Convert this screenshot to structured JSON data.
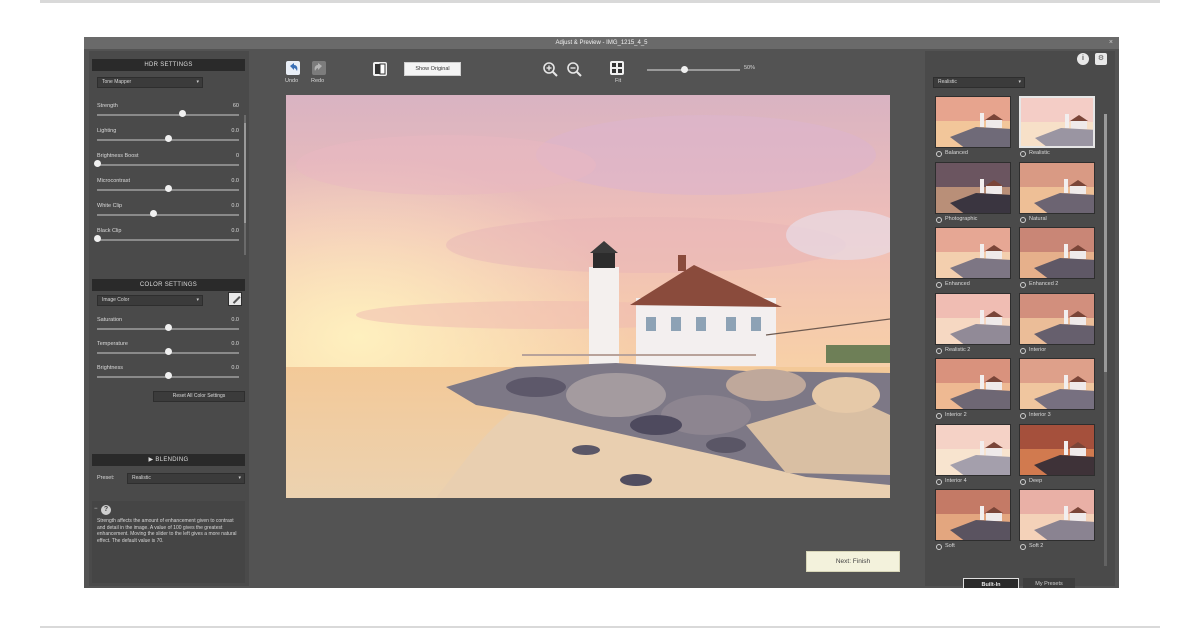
{
  "window": {
    "title": "Adjust & Preview - IMG_1215_4_5",
    "close_glyph": "×"
  },
  "left": {
    "hdr_settings_title": "HDR SETTINGS",
    "tone_dropdown": "Tone Mapper",
    "sliders": [
      {
        "label": "Strength",
        "value": "60",
        "level": 0.6
      },
      {
        "label": "Lighting",
        "value": "0.0",
        "level": 0.5
      },
      {
        "label": "Brightness Boost",
        "value": "0",
        "level": 0.0
      },
      {
        "label": "Microcontrast",
        "value": "0.0",
        "level": 0.5
      },
      {
        "label": "White Clip",
        "value": "0.0",
        "level": 0.4
      },
      {
        "label": "Black Clip",
        "value": "0.0",
        "level": 0.0
      }
    ],
    "color_settings_title": "COLOR SETTINGS",
    "color_dropdown": "Image Color",
    "color_sliders": [
      {
        "label": "Saturation",
        "value": "0.0",
        "level": 0.5
      },
      {
        "label": "Temperature",
        "value": "0.0",
        "level": 0.5
      },
      {
        "label": "Brightness",
        "value": "0.0",
        "level": 0.5
      }
    ],
    "reset_button": "Reset All Color Settings",
    "blending_title": "▶ BLENDING",
    "preset_label": "Preset:",
    "preset_value": "Realistic",
    "help_text": "Strength affects the amount of enhancement given to contrast and detail in the image. A value of 100 gives the greatest enhancement. Moving the slider to the left gives a more natural effect. The default value is 70."
  },
  "toolbar": {
    "undo_label": "Undo",
    "redo_label": "Redo",
    "show_original": "Show Original",
    "fit_label": "Fit",
    "zoom_value": "50%",
    "zoom_level": 0.4
  },
  "main": {
    "next_button": "Next: Finish"
  },
  "right": {
    "preset_dropdown": "Realistic",
    "info_glyph": "i",
    "settings_glyph": "⚙",
    "thumbnails": [
      {
        "name": "Balanced"
      },
      {
        "name": "Realistic",
        "selected": true
      },
      {
        "name": "Photographic"
      },
      {
        "name": "Natural"
      },
      {
        "name": "Enhanced"
      },
      {
        "name": "Enhanced 2"
      },
      {
        "name": "Realistic 2"
      },
      {
        "name": "Interior"
      },
      {
        "name": "Interior 2"
      },
      {
        "name": "Interior 3"
      },
      {
        "name": "Interior 4"
      },
      {
        "name": "Deep"
      },
      {
        "name": "Soft"
      },
      {
        "name": "Soft 2"
      }
    ],
    "tab_builtin": "Built-In",
    "tab_mypresets": "My Presets"
  },
  "colors": {
    "window_bg": "#535353",
    "panel_bg": "#4a4a4a",
    "header_bg": "#2a2a2a",
    "next_btn": "#f3f2dc"
  }
}
